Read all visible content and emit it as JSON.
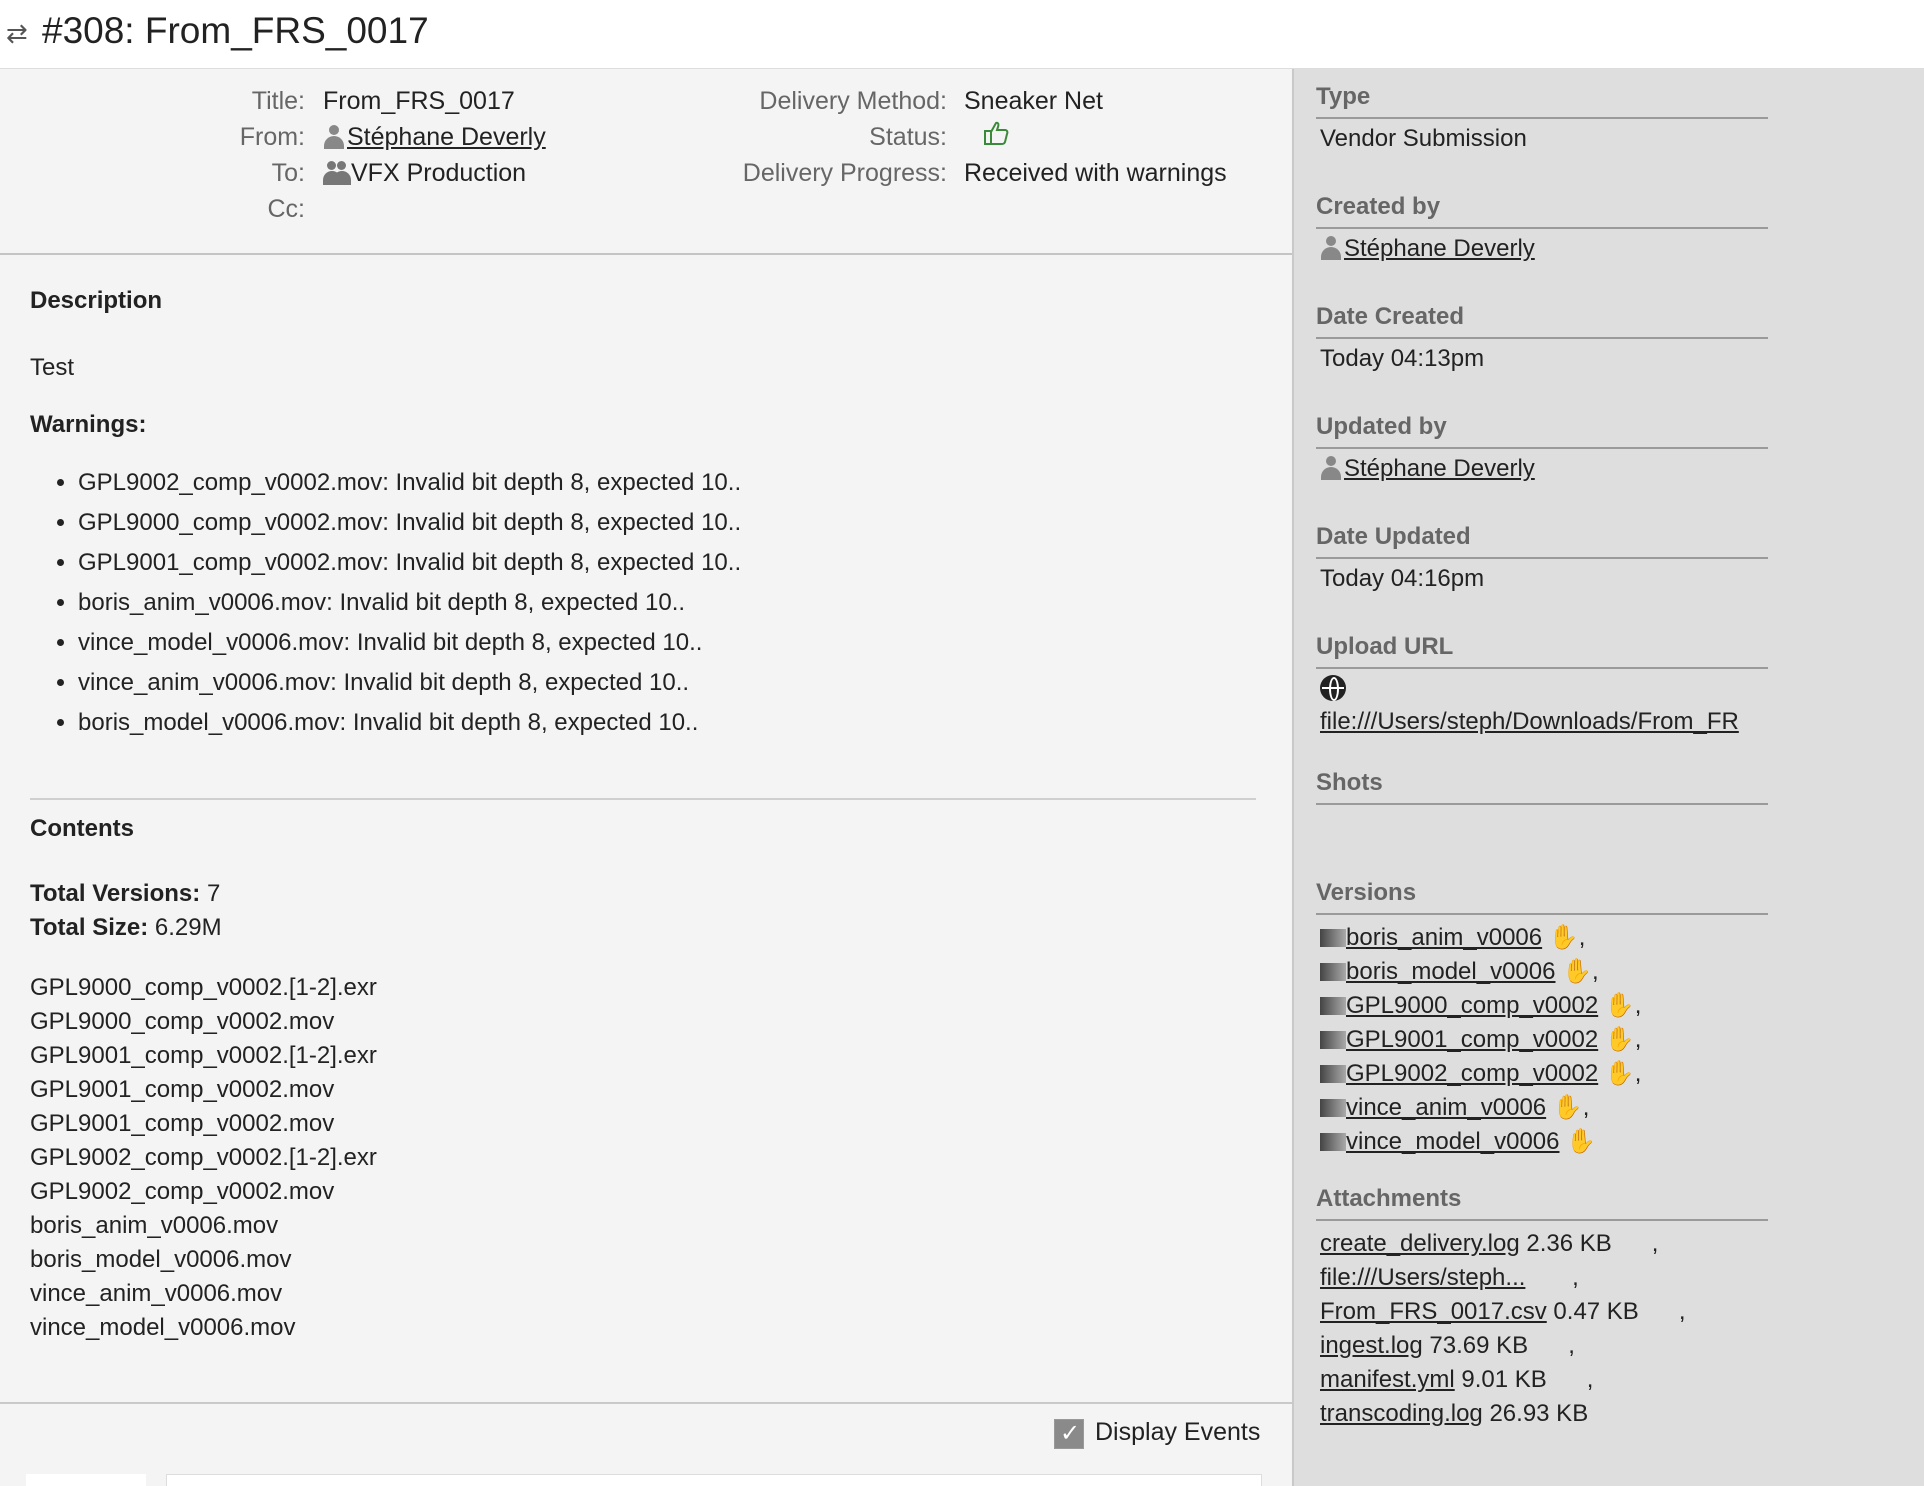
{
  "header": {
    "title": "#308: From_FRS_0017"
  },
  "meta": {
    "title_label": "Title:",
    "title_value": "From_FRS_0017",
    "from_label": "From:",
    "from_value": "Stéphane Deverly",
    "to_label": "To:",
    "to_value": "VFX Production",
    "cc_label": "Cc:",
    "cc_value": "",
    "delivery_method_label": "Delivery Method:",
    "delivery_method_value": "Sneaker Net",
    "status_label": "Status:",
    "status_icon": "thumbs-up-icon",
    "delivery_progress_label": "Delivery Progress:",
    "delivery_progress_value": "Received with warnings"
  },
  "description": {
    "heading": "Description",
    "text": "Test",
    "warnings_heading": "Warnings:",
    "warnings": [
      "GPL9002_comp_v0002.mov: Invalid bit depth 8, expected 10..",
      "GPL9000_comp_v0002.mov: Invalid bit depth 8, expected 10..",
      "GPL9001_comp_v0002.mov: Invalid bit depth 8, expected 10..",
      "boris_anim_v0006.mov: Invalid bit depth 8, expected 10..",
      "vince_model_v0006.mov: Invalid bit depth 8, expected 10..",
      "vince_anim_v0006.mov: Invalid bit depth 8, expected 10..",
      "boris_model_v0006.mov: Invalid bit depth 8, expected 10.."
    ]
  },
  "contents": {
    "heading": "Contents",
    "total_versions_label": "Total Versions:",
    "total_versions_value": "7",
    "total_size_label": "Total Size:",
    "total_size_value": "6.29M",
    "files": [
      "GPL9000_comp_v0002.[1-2].exr",
      "GPL9000_comp_v0002.mov",
      "GPL9001_comp_v0002.[1-2].exr",
      "GPL9001_comp_v0002.mov",
      "GPL9001_comp_v0002.mov",
      "GPL9002_comp_v0002.[1-2].exr",
      "GPL9002_comp_v0002.mov",
      "boris_anim_v0006.mov",
      "boris_model_v0006.mov",
      "vince_anim_v0006.mov",
      "vince_model_v0006.mov"
    ]
  },
  "footer": {
    "display_events_label": "Display Events",
    "display_events_checked": true
  },
  "sidebar": {
    "type_heading": "Type",
    "type_value": "Vendor Submission",
    "created_by_heading": "Created by",
    "created_by_value": "Stéphane Deverly",
    "date_created_heading": "Date Created",
    "date_created_value": "Today 04:13pm",
    "updated_by_heading": "Updated by",
    "updated_by_value": "Stéphane Deverly",
    "date_updated_heading": "Date Updated",
    "date_updated_value": "Today 04:16pm",
    "upload_url_heading": "Upload URL",
    "upload_url_value": "file:///Users/steph/Downloads/From_FR",
    "shots_heading": "Shots",
    "versions_heading": "Versions",
    "versions": [
      {
        "name": "boris_anim_v0006",
        "sep": ","
      },
      {
        "name": "boris_model_v0006",
        "sep": ","
      },
      {
        "name": "GPL9000_comp_v0002",
        "sep": ","
      },
      {
        "name": "GPL9001_comp_v0002",
        "sep": ","
      },
      {
        "name": "GPL9002_comp_v0002",
        "sep": ","
      },
      {
        "name": "vince_anim_v0006",
        "sep": ","
      },
      {
        "name": "vince_model_v0006",
        "sep": ""
      }
    ],
    "attachments_heading": "Attachments",
    "attachments": [
      {
        "name": "create_delivery.log",
        "size": "2.36 KB",
        "sep": ","
      },
      {
        "name": "file:///Users/steph...",
        "size": "",
        "sep": ","
      },
      {
        "name": "From_FRS_0017.csv",
        "size": "0.47 KB",
        "sep": ","
      },
      {
        "name": "ingest.log",
        "size": "73.69 KB",
        "sep": ","
      },
      {
        "name": "manifest.yml",
        "size": "9.01 KB",
        "sep": ","
      },
      {
        "name": "transcoding.log",
        "size": "26.93 KB",
        "sep": ""
      }
    ]
  },
  "colors": {
    "status_green": "#3a8a3a",
    "sidebar_bg": "#dedede",
    "main_bg": "#f4f4f4"
  }
}
